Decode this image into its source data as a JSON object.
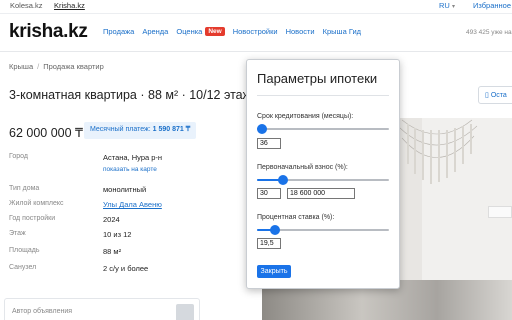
{
  "topbar": {
    "sites": [
      "Kolesa.kz",
      "Krisha.kz"
    ],
    "language": "RU",
    "favorites": "Избранное"
  },
  "header": {
    "logo": "krisha.kz",
    "nav": [
      "Продажа",
      "Аренда",
      "Оценка",
      "Новостройки",
      "Новости",
      "Крыша Гид"
    ],
    "new_badge": "New",
    "listing_count": "493 425 уже на"
  },
  "breadcrumb": [
    "Крыша",
    "Продажа квартир"
  ],
  "listing": {
    "title": "3-комнатная квартира · 88 м² · 10/12 этаж",
    "action_button": "Оста",
    "price": "62 000 000 ₸",
    "monthly_payment_label": "Месячный платеж:",
    "monthly_payment_value": "1 590 871 ₸",
    "properties": [
      {
        "key": "Город",
        "value": "Астана, Нура р-н"
      },
      {
        "key": "Тип дома",
        "value": "монолитный"
      },
      {
        "key": "Жилой комплекс",
        "value": "Улы Дала Авеню"
      },
      {
        "key": "Год постройки",
        "value": "2024"
      },
      {
        "key": "Этаж",
        "value": "10 из 12"
      },
      {
        "key": "Площадь",
        "value": "88 м²"
      },
      {
        "key": "Санузел",
        "value": "2 с/у и более"
      }
    ],
    "show_on_map": "показать на карте",
    "author_label": "Автор объявления"
  },
  "modal": {
    "title": "Параметры ипотеки",
    "term_label": "Срок кредитования (месяцы):",
    "term_value": "36",
    "term_fraction": 0.04,
    "down_label": "Первоначальный взнос (%):",
    "down_value": "30",
    "down_amount": "18 600 000",
    "down_fraction": 0.2,
    "rate_label": "Процентная ставка (%):",
    "rate_value": "19,5",
    "rate_fraction": 0.14,
    "calculate_button": "Закрыть"
  },
  "colors": {
    "accent": "#1a73e8",
    "link": "#1a6fc9",
    "new_badge": "#e43b2d"
  }
}
